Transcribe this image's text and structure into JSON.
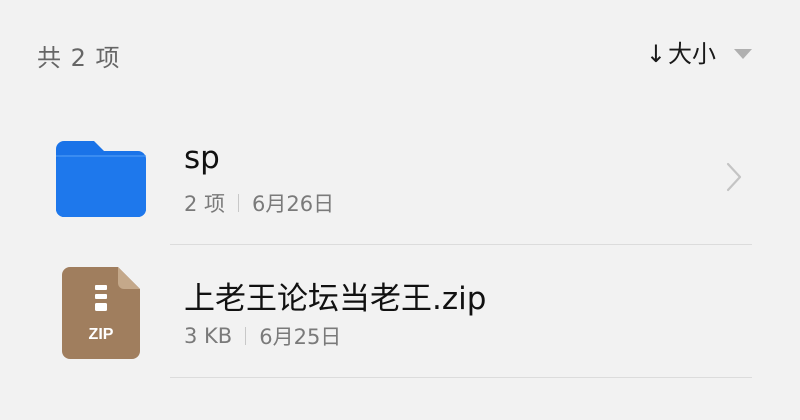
{
  "header": {
    "item_count": "共 2 项",
    "sort_arrow": "↓",
    "sort_label": "大小",
    "sort_caret_icon": "caret-down-icon"
  },
  "files": [
    {
      "type": "folder",
      "icon": "folder-icon",
      "icon_color": "#1a73e8",
      "name": "sp",
      "meta_primary": "2 项",
      "meta_date": "6月26日",
      "trailing_icon": "chevron-right-icon"
    },
    {
      "type": "zip",
      "icon": "zip-file-icon",
      "icon_color": "#a07e5e",
      "icon_label": "ZIP",
      "name": "上老王论坛当老王.zip",
      "meta_primary": "3 KB",
      "meta_date": "6月25日"
    }
  ],
  "colors": {
    "background": "#f2f2f2",
    "divider": "#dcdcdc",
    "secondary_text": "#7a7a7a"
  }
}
